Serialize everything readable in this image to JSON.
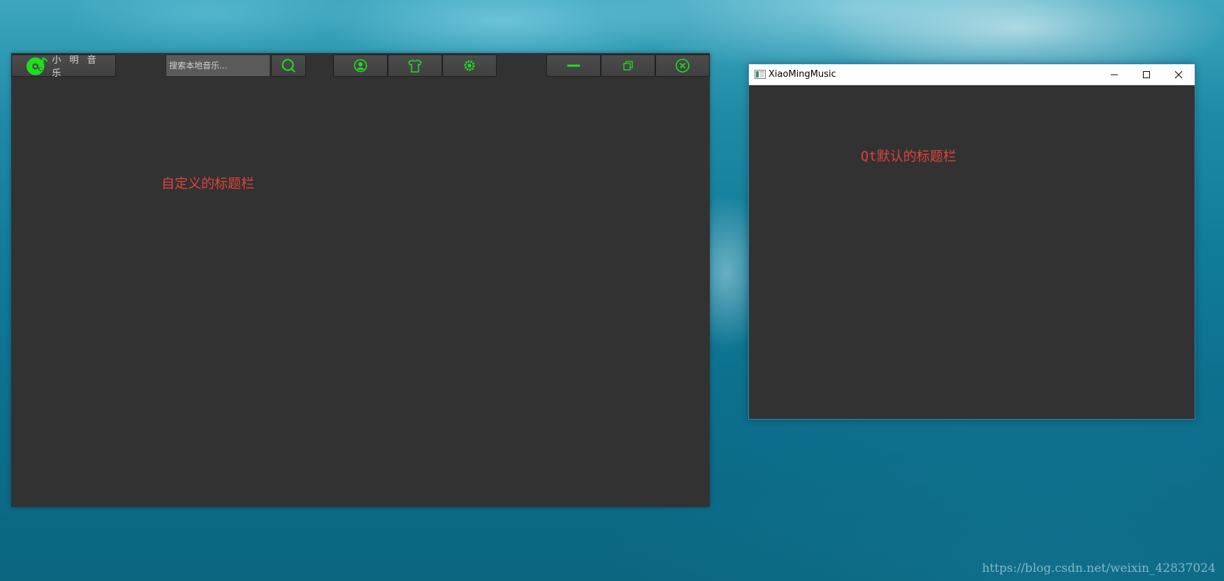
{
  "custom_window": {
    "logo_text": "小 明 音 乐",
    "search_placeholder": "搜索本地音乐...",
    "annotation": "自定义的标题栏",
    "accent_color": "#1ee01e",
    "icons": {
      "logo": "music-disc-note-icon",
      "search": "magnifier-icon",
      "user": "user-avatar-icon",
      "skin": "tshirt-icon",
      "settings": "gear-icon",
      "minimize": "dash-icon",
      "restore": "restore-windows-icon",
      "close": "circle-x-icon"
    }
  },
  "qt_window": {
    "title": "XiaoMingMusic",
    "annotation": "Qt默认的标题栏",
    "icons": {
      "minimize": "minimize-icon",
      "maximize": "maximize-icon",
      "close": "close-icon"
    }
  },
  "watermark": "https://blog.csdn.net/weixin_42837024",
  "colors": {
    "window_bg": "#323232",
    "annotation": "#e0423a",
    "qt_border": "#3a7fb8"
  }
}
